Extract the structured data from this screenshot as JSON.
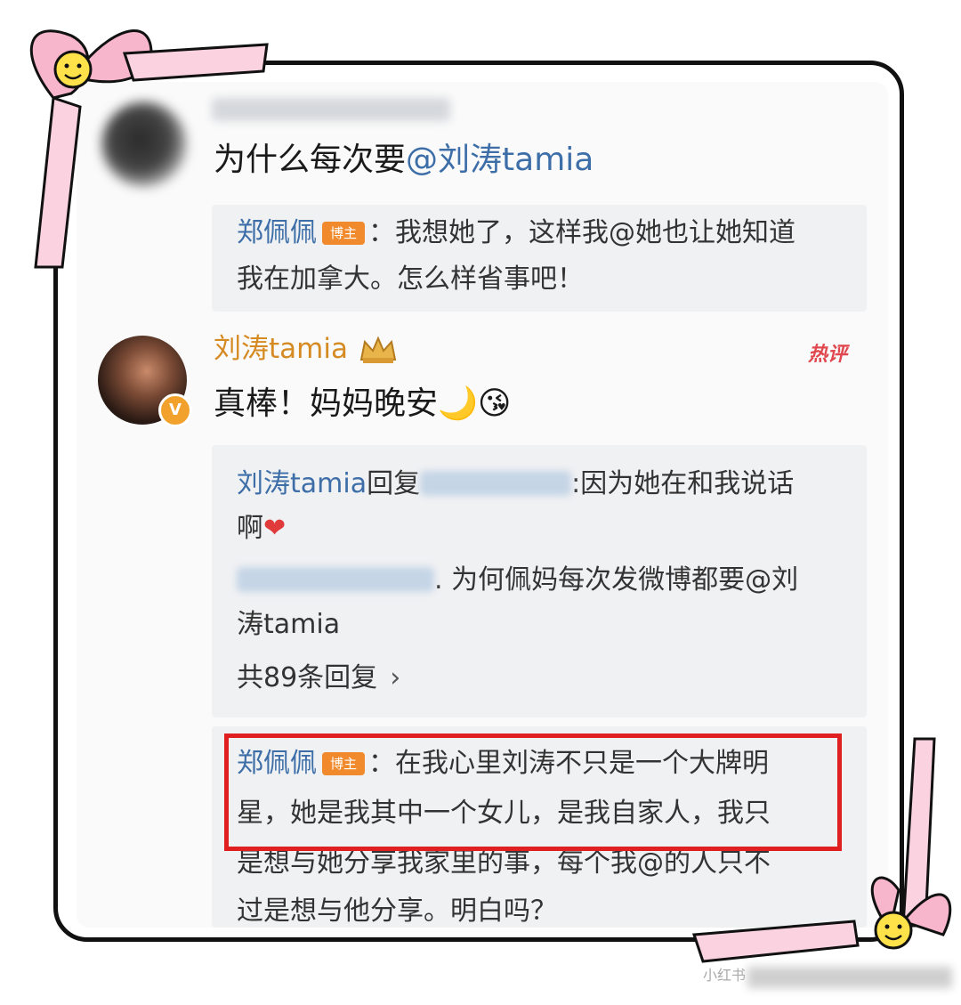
{
  "comment": {
    "text_prefix": "为什么每次要",
    "mention": "@刘涛tamia"
  },
  "quote1": {
    "user": "郑佩佩",
    "tag": "博主",
    "line1": "：我想她了，这样我@她也让她知道",
    "line2": "我在加拿大。怎么样省事吧！"
  },
  "reply": {
    "user": "刘涛tamia",
    "hot_label": "热评",
    "text": "真棒！妈妈晚安",
    "moon_emoji": "🌙",
    "kiss_emoji": "😘",
    "verified_badge": "V"
  },
  "thread": {
    "r1_user": "刘涛tamia",
    "r1_reply_word": "回复",
    "r1_text": ":因为她在和我说话",
    "r1_line2": "啊",
    "heart": "❤",
    "r2_text": ". 为何佩妈每次发微博都要@刘",
    "r2_line2": "涛tamia",
    "more_label": "共89条回复",
    "more_chevron": "›"
  },
  "quote2": {
    "user": "郑佩佩",
    "tag": "博主",
    "line1": "：在我心里刘涛不只是一个大牌明",
    "line2": "星，她是我其中一个女儿，是我自家人，我只",
    "line3": "是想与她分享我家里的事，每个我@的人只不",
    "line4": "过是想与他分享。明白吗？"
  },
  "watermark": {
    "text": "小红书"
  },
  "colors": {
    "frame": "#111111",
    "ribbon": "#f7b6cc",
    "highlight_box": "#e02020",
    "username": "#3d6ea8",
    "gold_name": "#d68a22"
  }
}
